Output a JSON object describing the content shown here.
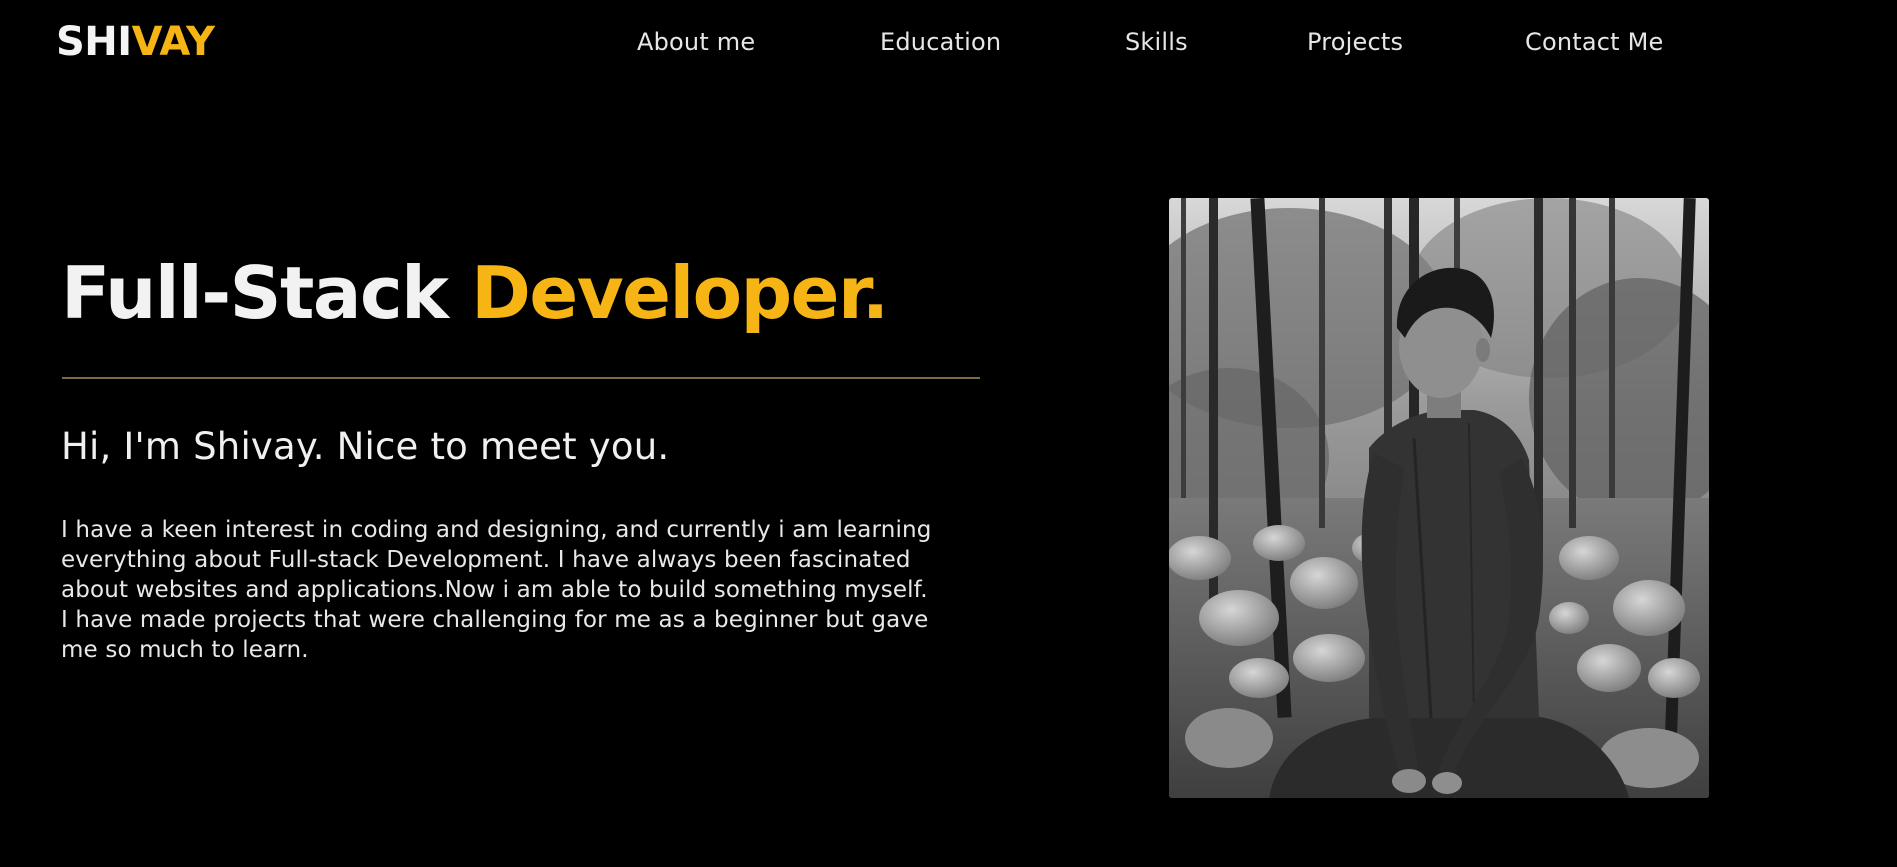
{
  "brand": {
    "logo_part1": "SHI",
    "logo_part2": "VAY",
    "accent_color": "#f7b515"
  },
  "nav": {
    "items": [
      {
        "label": "About me"
      },
      {
        "label": "Education"
      },
      {
        "label": "Skills"
      },
      {
        "label": "Projects"
      },
      {
        "label": "Contact Me"
      }
    ]
  },
  "hero": {
    "title_part1": "Full-Stack ",
    "title_part2": "Developer.",
    "greeting": "Hi, I'm Shivay. Nice to meet you.",
    "about_lines": [
      "I have a keen interest in coding and designing, and currently i am learning",
      "everything about Full-stack Development. I have always been fascinated",
      "about websites and applications.Now i am able to build something myself.",
      "I have made projects that were challenging for me as a beginner but gave",
      "me so much to learn."
    ]
  },
  "portrait": {
    "style": "black-and-white",
    "subject": "person seated in a forest with rocks and trees"
  }
}
